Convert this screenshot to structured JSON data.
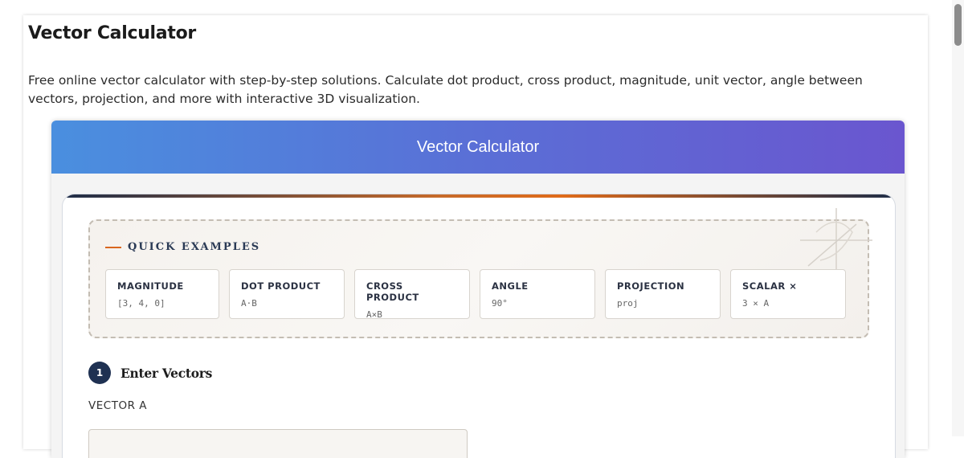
{
  "page": {
    "title": "Vector Calculator",
    "intro": "Free online vector calculator with step-by-step solutions. Calculate dot product, cross product, magnitude, unit vector, angle between vectors, projection, and more with interactive 3D visualization."
  },
  "calculator": {
    "header_title": "Vector Calculator",
    "examples": {
      "title": "QUICK EXAMPLES",
      "items": [
        {
          "label": "MAGNITUDE",
          "sub": "[3, 4, 0]"
        },
        {
          "label": "DOT PRODUCT",
          "sub": "A·B"
        },
        {
          "label": "CROSS PRODUCT",
          "sub": "A×B"
        },
        {
          "label": "ANGLE",
          "sub": "90°"
        },
        {
          "label": "PROJECTION",
          "sub": "proj"
        },
        {
          "label": "SCALAR ×",
          "sub": "3 × A"
        }
      ]
    },
    "step1": {
      "number": "1",
      "title": "Enter Vectors"
    },
    "vector_a": {
      "label": "VECTOR A",
      "value": ""
    }
  },
  "colors": {
    "header_gradient_start": "#4a8fdf",
    "header_gradient_end": "#6a56cf",
    "accent_orange": "#d9661e",
    "navy": "#1f3152"
  }
}
